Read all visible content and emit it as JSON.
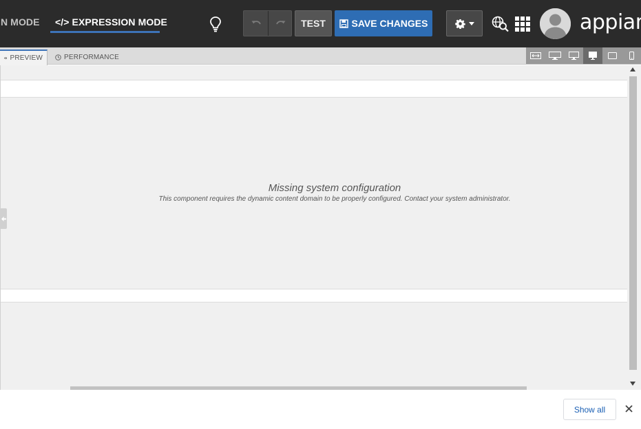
{
  "header": {
    "design_mode_label": "IGN MODE",
    "expression_mode_label": "EXPRESSION MODE",
    "expression_mode_glyph": "</>",
    "test_label": "TEST",
    "save_label": "SAVE CHANGES",
    "logo_text": "appian"
  },
  "tabs": {
    "preview": "PREVIEW",
    "performance": "PERFORMANCE"
  },
  "content": {
    "message_title": "Missing system configuration",
    "message_body": "This component requires the dynamic content domain to be properly configured. Contact your system administrator."
  },
  "download_bar": {
    "show_all_label": "Show all"
  },
  "icons": [
    "lightbulb-icon",
    "undo-icon",
    "redo-icon",
    "save-icon",
    "gear-icon",
    "chevron-down-icon",
    "globe-search-icon",
    "app-grid-icon",
    "user-avatar-icon",
    "eye-icon",
    "clock-icon",
    "fit-width-icon",
    "desktop-wide-icon",
    "desktop-icon",
    "desktop-small-icon",
    "tablet-icon",
    "phone-icon",
    "close-icon"
  ],
  "colors": {
    "topbar": "#2b2b2b",
    "accent": "#2e6db4",
    "canvas": "#f0f0f0"
  }
}
